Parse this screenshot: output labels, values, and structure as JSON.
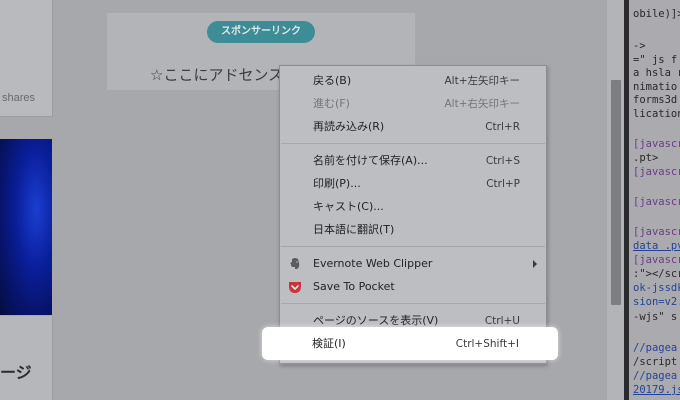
{
  "sidebar": {
    "shares_label": "shares",
    "page_label": "ージ"
  },
  "sponsor": {
    "badge": "スポンサーリンク",
    "ad_placeholder": "☆ここにアドセンス"
  },
  "context_menu": {
    "group1": [
      {
        "label": "戻る(B)",
        "shortcut": "Alt+左矢印キー",
        "enabled": true
      },
      {
        "label": "進む(F)",
        "shortcut": "Alt+右矢印キー",
        "enabled": false
      },
      {
        "label": "再読み込み(R)",
        "shortcut": "Ctrl+R",
        "enabled": true
      }
    ],
    "group2": [
      {
        "label": "名前を付けて保存(A)...",
        "shortcut": "Ctrl+S",
        "enabled": true
      },
      {
        "label": "印刷(P)...",
        "shortcut": "Ctrl+P",
        "enabled": true
      },
      {
        "label": "キャスト(C)...",
        "shortcut": "",
        "enabled": true
      },
      {
        "label": "日本語に翻訳(T)",
        "shortcut": "",
        "enabled": true
      }
    ],
    "group3": [
      {
        "label": "Evernote Web Clipper",
        "icon": "evernote-elephant-icon",
        "has_submenu": true
      },
      {
        "label": "Save To Pocket",
        "icon": "pocket-icon",
        "has_submenu": false
      }
    ],
    "group4": [
      {
        "label": "ページのソースを表示(V)",
        "shortcut": "Ctrl+U",
        "enabled": true
      },
      {
        "label": "検証(I)",
        "shortcut": "Ctrl+Shift+I",
        "enabled": true,
        "highlighted": true
      }
    ]
  },
  "devtools": {
    "lines": [
      "obile)]>",
      "->",
      "=\" js f",
      "a hsla r",
      "nimatio",
      "forms3d",
      "lication",
      "[javascr",
      ".pt>",
      "[javascr",
      "[javascr",
      "[javascr",
      "data .pv",
      "[javascr",
      ":\"></scr",
      "ok-jssdk",
      "sion=v2.",
      "-wjs\" s",
      "//pagea",
      "/script",
      "//pagea",
      "20179.js"
    ]
  },
  "colors": {
    "overlay_bg": "#a7a8ac",
    "sponsor_badge": "#3e8c95",
    "pocket_red": "#c9343f",
    "evernote_gray": "#5b5c60"
  }
}
